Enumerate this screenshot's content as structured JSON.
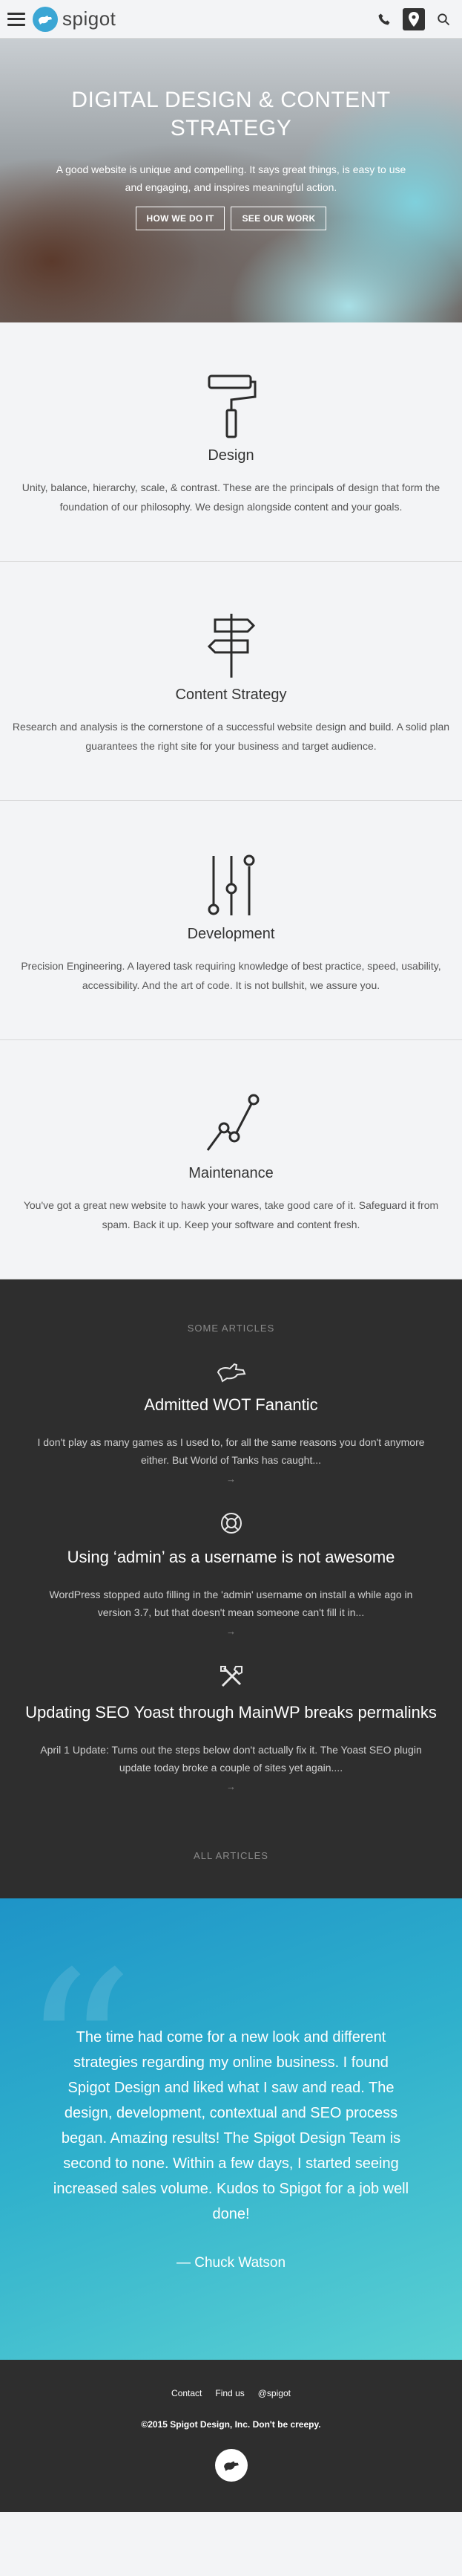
{
  "header": {
    "logo_text": "spigot",
    "icons": [
      "menu-icon",
      "phone-icon",
      "map-pin-icon",
      "search-icon"
    ]
  },
  "hero": {
    "title": "Digital Design & Content Strategy",
    "text": "A good website is unique and compelling. It says great things, is easy to use and engaging, and inspires meaningful action.",
    "buttons": [
      "How we do it",
      "See our work"
    ]
  },
  "services": [
    {
      "icon": "paint-roller-icon",
      "title": "Design",
      "text": "Unity, balance, hierarchy, scale, & contrast. These are the principals of design that form the foundation of our philosophy. We design alongside content and your goals."
    },
    {
      "icon": "signpost-icon",
      "title": "Content Strategy",
      "text": "Research and analysis is the cornerstone of a successful website design and build. A solid plan guarantees the right site for your business and target audience."
    },
    {
      "icon": "sliders-icon",
      "title": "Development",
      "text": "Precision Engineering. A layered task requiring knowledge of best practice, speed, usability, accessibility. And the art of code. It is not bullshit, we assure you."
    },
    {
      "icon": "line-graph-icon",
      "title": "Maintenance",
      "text": "You've got a great new website to hawk your wares, take good care of it. Safeguard it from spam. Back it up. Keep your software and content fresh."
    }
  ],
  "articles": {
    "label": "Some articles",
    "items": [
      {
        "icon": "plane-icon",
        "title": "Admitted WOT Fanantic",
        "excerpt": "I don't play as many games as I used to, for all the same reasons you don't anymore either. But World of Tanks has caught...",
        "more": "→"
      },
      {
        "icon": "lifebuoy-icon",
        "title": "Using ‘admin’ as a username is not awesome",
        "excerpt": "WordPress stopped auto filling in the 'admin' username on install a while ago in version 3.7, but that doesn't mean someone can't fill it in...",
        "more": "→"
      },
      {
        "icon": "tools-icon",
        "title": "Updating SEO Yoast through MainWP breaks permalinks",
        "excerpt": "April 1 Update: Turns out the steps below don't actually fix it. The Yoast SEO plugin update today broke a couple of sites yet again....",
        "more": "→"
      }
    ],
    "all_label": "All articles"
  },
  "testimonial": {
    "quote_mark": "“",
    "quote": "The time had come for a new look and different strategies regarding my online business. I found Spigot Design and liked what I saw and read. The design, development, contextual and SEO process began. Amazing results! The Spigot Design Team is second to none. Within a few days, I started seeing increased sales volume. Kudos to Spigot for a job well done!",
    "author": "—  Chuck Watson"
  },
  "footer": {
    "links": [
      "Contact",
      "Find us",
      "@spigot"
    ],
    "copyright": "©2015 Spigot Design, Inc. Don't be creepy."
  },
  "colors": {
    "brand_blue": "#3ba6d4",
    "dark_bg": "#2e2e2e",
    "light_bg": "#f3f4f6",
    "testimonial_start": "#1e94c8",
    "testimonial_end": "#5ad0d3"
  }
}
